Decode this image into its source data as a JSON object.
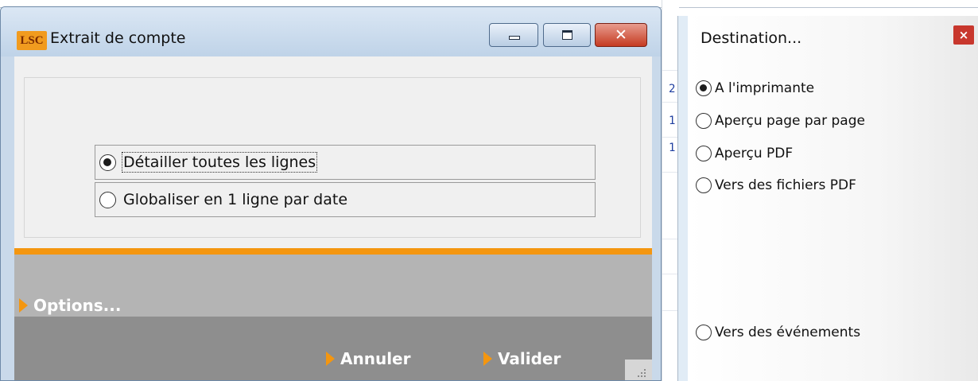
{
  "main_window": {
    "title": "Extrait de compte",
    "logo_text": "LSC",
    "minimize_icon": "minimize-icon",
    "maximize_icon": "maximize-icon",
    "close_glyph": "✕",
    "choices": [
      {
        "label": "Détailler toutes les lignes",
        "checked": true
      },
      {
        "label": "Globaliser en 1 ligne par date",
        "checked": false
      }
    ],
    "options_label": "Options...",
    "cancel_label": "Annuler",
    "validate_label": "Valider",
    "accent_color": "#f4960f"
  },
  "background_app": {
    "fragments": [
      "2",
      "1",
      "1"
    ]
  },
  "destination_window": {
    "title": "Destination...",
    "close_glyph": "×",
    "options": [
      {
        "label": "A l'imprimante",
        "checked": true
      },
      {
        "label": "Aperçu page par page",
        "checked": false
      },
      {
        "label": "Aperçu PDF",
        "checked": false
      },
      {
        "label": "Vers des fichiers PDF",
        "checked": false
      },
      {
        "label": "Vers des événements",
        "checked": false
      }
    ]
  }
}
